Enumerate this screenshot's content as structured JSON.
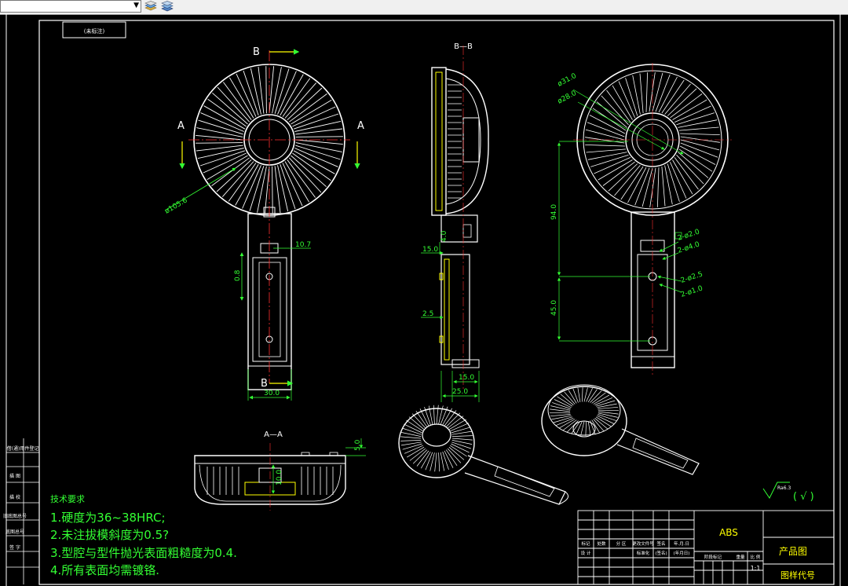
{
  "toolbar": {
    "layer_combo_value": "",
    "icons": [
      "layer-stack-icon",
      "layer-states-icon"
    ]
  },
  "drawing": {
    "stamp_label": "(未标注)",
    "sections": {
      "b_label": "B",
      "a_label": "A",
      "bb_title": "B—B",
      "aa_title": "A—A"
    },
    "dimensions": {
      "front_diameter": "ø105.6",
      "front_slot_width": "10.7",
      "front_slot_depth": "0.8",
      "front_handle_width": "30.0",
      "side_step": "4.0",
      "side_flange": "15.0",
      "side_wall": "2.5",
      "side_base_inner": "15.0",
      "side_base_total": "25.0",
      "right_dia_outer": "ø31.0",
      "right_dia_inner": "ø28.0",
      "right_height_top": "94.0",
      "right_height_bottom": "45.0",
      "right_hole_1": "2-ø2.0",
      "right_hole_2": "2-ø4.0",
      "right_hole_3": "2-ø2.5",
      "right_hole_4": "2-ø1.0",
      "aa_height": "5.0",
      "aa_slot": "10.0"
    },
    "tech_requirements": {
      "heading": "技术要求",
      "items": [
        "1.硬度为36~38HRC;",
        "2.未注拔模斜度为0.5?",
        "3.型腔与型件抛光表面粗糙度为0.4.",
        "4.所有表面均需镀铬."
      ]
    },
    "surface_finish": {
      "symbol": "Ra6.3",
      "remark": "(  √  )"
    },
    "title_block": {
      "material": "ABS",
      "drawing_name": "产品图",
      "drawing_code_label": "图样代号",
      "scale": "1:1",
      "row_labels": [
        "标记",
        "处数",
        "分  区",
        "更改文件号",
        "签名",
        "年.月.日"
      ],
      "design_labels": [
        "设 计",
        "标准化",
        "(签名)",
        "(年月日)"
      ],
      "stage_labels": [
        "阶段标记",
        "重量",
        "比 例"
      ]
    },
    "left_strip_labels": [
      "借(通)用件登记",
      "描 图",
      "描 校",
      "旧底图总号",
      "底图总号",
      "签 字"
    ]
  }
}
